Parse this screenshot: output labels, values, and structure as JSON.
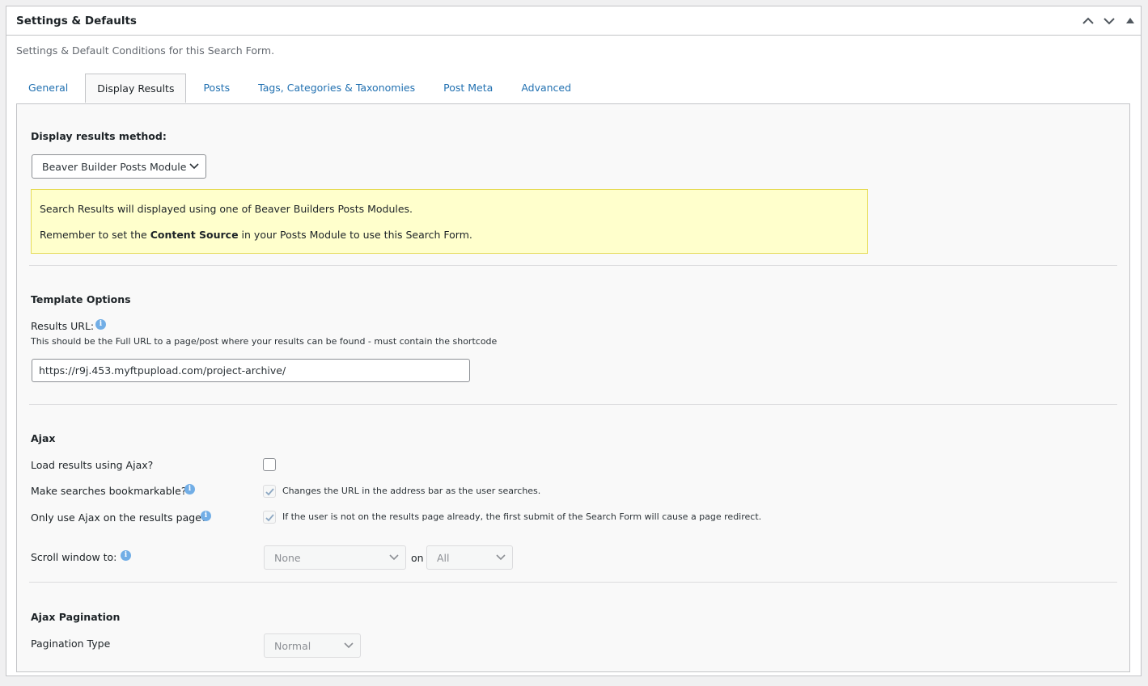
{
  "panel": {
    "title": "Settings & Defaults",
    "description": "Settings & Default Conditions for this Search Form."
  },
  "tabs": [
    {
      "label": "General"
    },
    {
      "label": "Display Results"
    },
    {
      "label": "Posts"
    },
    {
      "label": "Tags, Categories & Taxonomies"
    },
    {
      "label": "Post Meta"
    },
    {
      "label": "Advanced"
    }
  ],
  "display_results": {
    "method_label": "Display results method:",
    "method_value": "Beaver Builder Posts Module",
    "notice_line1": "Search Results will displayed using one of Beaver Builders Posts Modules.",
    "notice_line2_a": "Remember to set the ",
    "notice_line2_b": "Content Source",
    "notice_line2_c": " in your Posts Module to use this Search Form."
  },
  "template_options": {
    "heading": "Template Options",
    "results_url_label": "Results URL:",
    "results_url_help": "This should be the Full URL to a page/post where your results can be found - must contain the shortcode",
    "results_url_value": "https://r9j.453.myftpupload.com/project-archive/"
  },
  "ajax": {
    "heading": "Ajax",
    "load_label": "Load results using Ajax?",
    "bookmark_label": "Make searches bookmarkable?",
    "bookmark_desc": "Changes the URL in the address bar as the user searches.",
    "only_results_label": "Only use Ajax on the results page?",
    "only_results_desc": "If the user is not on the results page already, the first submit of the Search Form will cause a page redirect.",
    "scroll_label": "Scroll window to:",
    "scroll_value": "None",
    "scroll_on": "on",
    "scroll_on_value": "All"
  },
  "ajax_pagination": {
    "heading": "Ajax Pagination",
    "type_label": "Pagination Type",
    "type_value": "Normal"
  },
  "colors": {
    "link": "#2271b1",
    "notice_bg": "#ffffcc",
    "notice_border": "#e6db55",
    "info_icon": "#72aee6"
  }
}
